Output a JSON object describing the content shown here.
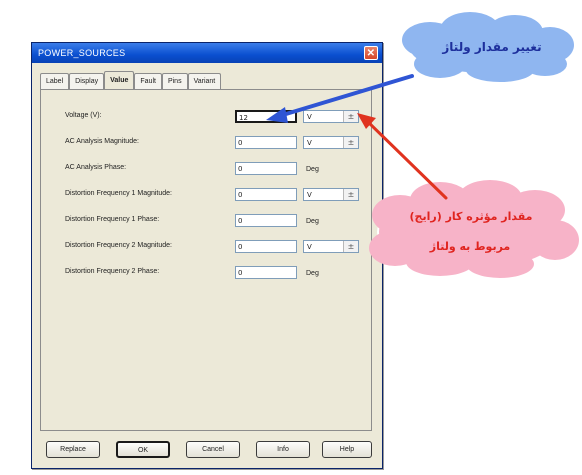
{
  "window": {
    "title": "POWER_SOURCES",
    "close_glyph": "✕"
  },
  "tabs": [
    {
      "label": "Label",
      "active": false
    },
    {
      "label": "Display",
      "active": false
    },
    {
      "label": "Value",
      "active": true
    },
    {
      "label": "Fault",
      "active": false
    },
    {
      "label": "Pins",
      "active": false
    },
    {
      "label": "Variant",
      "active": false
    }
  ],
  "fields": [
    {
      "label": "Voltage (V):",
      "value": "12",
      "unit": "V",
      "unit_type": "select"
    },
    {
      "label": "AC Analysis Magnitude:",
      "value": "0",
      "unit": "V",
      "unit_type": "select"
    },
    {
      "label": "AC Analysis Phase:",
      "value": "0",
      "unit": "Deg",
      "unit_type": "text"
    },
    {
      "label": "Distortion Frequency 1 Magnitude:",
      "value": "0",
      "unit": "V",
      "unit_type": "select"
    },
    {
      "label": "Distortion Frequency 1 Phase:",
      "value": "0",
      "unit": "Deg",
      "unit_type": "text"
    },
    {
      "label": "Distortion Frequency 2 Magnitude:",
      "value": "0",
      "unit": "V",
      "unit_type": "select"
    },
    {
      "label": "Distortion Frequency 2 Phase:",
      "value": "0",
      "unit": "Deg",
      "unit_type": "text"
    }
  ],
  "spin_glyph": "±",
  "buttons": {
    "replace": "Replace",
    "ok": "OK",
    "cancel": "Cancel",
    "info": "Info",
    "help": "Help"
  },
  "annotations": {
    "top_cloud": "تغییر مقدار ولتاژ",
    "right_cloud_line1": "مقدار  مؤثره کار  (رایج)",
    "right_cloud_line2": "مربوط به ولتاژ"
  },
  "colors": {
    "title_bar": "#0a4fd0",
    "blue_arrow": "#2f55d4",
    "red_arrow": "#e0331f",
    "blue_cloud": "#8fb6f0",
    "pink_cloud": "#f7b3c8",
    "blue_cloud_text": "#1d2f9c",
    "red_cloud_text": "#e0241f"
  }
}
